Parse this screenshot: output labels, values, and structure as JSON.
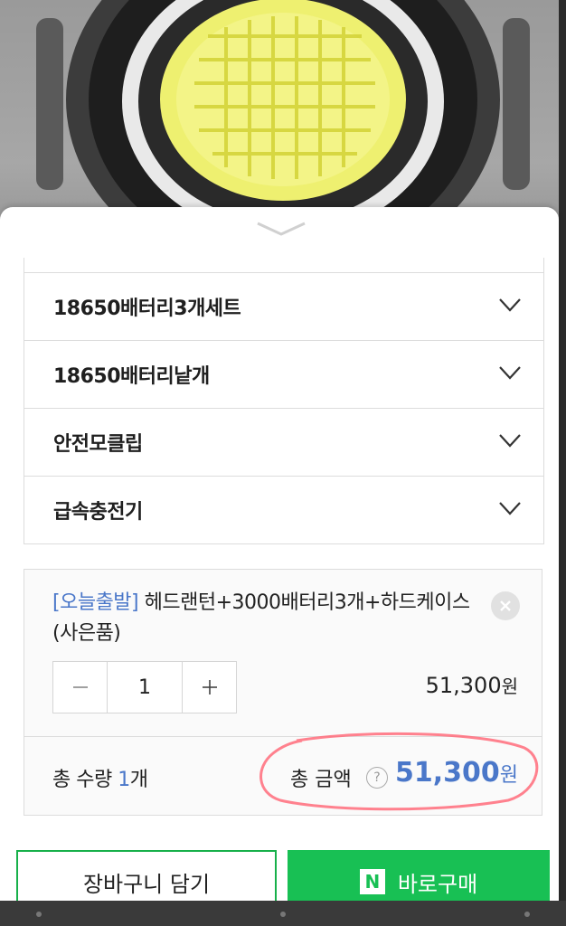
{
  "options": [
    {
      "label": "18650배터리3개세트"
    },
    {
      "label": "18650배터리낱개"
    },
    {
      "label": "안전모클립"
    },
    {
      "label": "급속충전기"
    }
  ],
  "cart_item": {
    "tag": "[오늘출발]",
    "title": " 헤드랜턴+3000배터리3개+하드케이스(사은품)",
    "quantity": "1",
    "price": "51,300",
    "price_unit": "원"
  },
  "summary": {
    "qty_label": "총 수량 ",
    "qty_value": "1",
    "qty_unit": "개",
    "amount_label": "총 금액",
    "help": "?",
    "amount_value": "51,300",
    "amount_unit": "원"
  },
  "actions": {
    "cart_label": "장바구니 담기",
    "buy_badge": "N",
    "buy_label": "바로구매"
  },
  "colors": {
    "accent_blue": "#4a77c9",
    "naver_green": "#18c054",
    "highlight": "#ff6b7a"
  }
}
